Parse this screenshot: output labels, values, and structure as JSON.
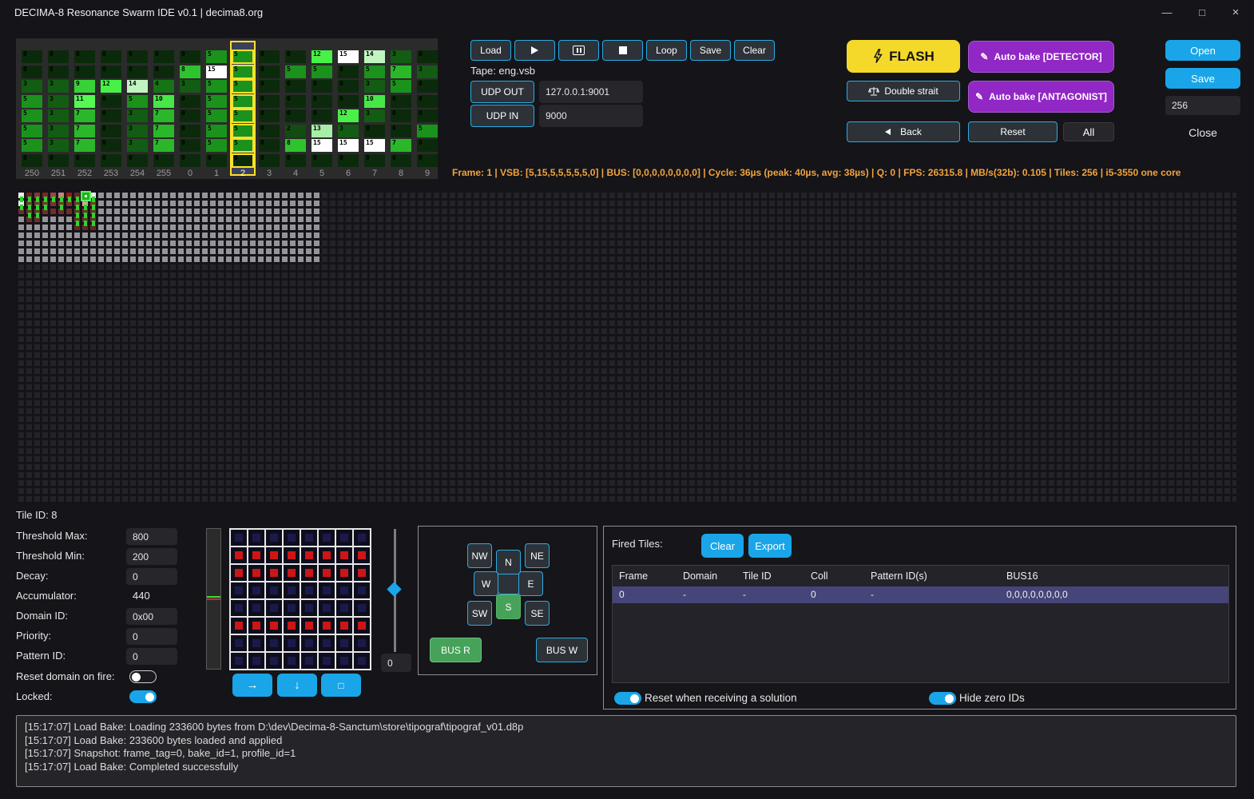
{
  "window": {
    "title": "DECIMA-8 Resonance Swarm IDE v0.1 | decima8.org",
    "minimize": "—",
    "maximize": "□",
    "close": "×"
  },
  "colors": {
    "accent_cyan": "#19a5e8",
    "border_cyan": "#2aabe2",
    "accent_yellow": "#f5d92a",
    "accent_purple": "#9127c4",
    "accent_green": "#46a259",
    "status_orange": "#f2a33c",
    "row_highlight": "#45457a",
    "pattern_red": "#cc1616",
    "pattern_navy": "#1a1a4a"
  },
  "vsb_panel": {
    "selected_index": 8,
    "heat_palette": [
      "#0b2a0b",
      "#0d360d",
      "#124c12",
      "#135c13",
      "#167316",
      "#1b921b",
      "#22a822",
      "#2ab82a",
      "#2ec42e",
      "#38d238",
      "#46e846",
      "#52fa52",
      "#48f048",
      "#a8eea8",
      "#c2f4c2",
      "#ffffff"
    ],
    "columns": [
      {
        "label": "250",
        "values": [
          0,
          0,
          3,
          5,
          5,
          5,
          5,
          0
        ]
      },
      {
        "label": "251",
        "values": [
          0,
          0,
          3,
          3,
          3,
          3,
          3,
          0
        ]
      },
      {
        "label": "252",
        "values": [
          0,
          0,
          9,
          11,
          7,
          7,
          7,
          0
        ]
      },
      {
        "label": "253",
        "values": [
          0,
          0,
          12,
          0,
          0,
          0,
          0,
          0
        ]
      },
      {
        "label": "254",
        "values": [
          0,
          0,
          14,
          5,
          3,
          3,
          3,
          0
        ]
      },
      {
        "label": "255",
        "values": [
          0,
          0,
          4,
          10,
          7,
          7,
          7,
          0
        ]
      },
      {
        "label": "0",
        "values": [
          0,
          8,
          3,
          0,
          0,
          0,
          0,
          0
        ]
      },
      {
        "label": "1",
        "values": [
          5,
          15,
          5,
          5,
          5,
          5,
          5,
          0
        ]
      },
      {
        "label": "2",
        "values": [
          5,
          5,
          5,
          5,
          5,
          5,
          5,
          0
        ]
      },
      {
        "label": "3",
        "values": [
          0,
          0,
          0,
          0,
          0,
          0,
          0,
          0
        ]
      },
      {
        "label": "4",
        "values": [
          0,
          5,
          0,
          0,
          0,
          2,
          8,
          0
        ]
      },
      {
        "label": "5",
        "values": [
          12,
          5,
          0,
          0,
          0,
          13,
          15,
          0
        ]
      },
      {
        "label": "6",
        "values": [
          15,
          0,
          0,
          0,
          12,
          3,
          15,
          0
        ]
      },
      {
        "label": "7",
        "values": [
          14,
          5,
          3,
          10,
          3,
          0,
          15,
          0
        ]
      },
      {
        "label": "8",
        "values": [
          3,
          7,
          5,
          0,
          0,
          0,
          7,
          0
        ]
      },
      {
        "label": "9",
        "values": [
          0,
          3,
          0,
          0,
          0,
          5,
          0,
          0
        ]
      }
    ]
  },
  "transport": {
    "load": "Load",
    "loop": "Loop",
    "save": "Save",
    "clear": "Clear",
    "tape_label": "Tape: eng.vsb",
    "udp_out_button": "UDP OUT",
    "udp_out_value": "127.0.0.1:9001",
    "udp_in_button": "UDP IN",
    "udp_in_value": "9000"
  },
  "bake": {
    "flash": "FLASH",
    "detector": "Auto bake [DETECTOR]",
    "double_strait": "Double strait",
    "antagonist": "Auto bake [ANTAGONIST]",
    "back": "Back",
    "reset": "Reset",
    "all": "All"
  },
  "file_panel": {
    "open": "Open",
    "save": "Save",
    "tiles_value": "256",
    "close": "Close"
  },
  "status_bar": {
    "text": "Frame: 1 | VSB: [5,15,5,5,5,5,5,0] | BUS: [0,0,0,0,0,0,0,0] | Cycle: 36µs (peak: 40µs, avg: 38µs) | Q: 0 | FPS: 26315.8 | MB/s(32b): 0.105 | Tiles: 256 | i5-3550 one core"
  },
  "tile_map": {
    "cols": 152,
    "rows": 39,
    "light_region": {
      "cols": 38,
      "rows": 9
    },
    "selected": {
      "row": 0,
      "col": 8,
      "fill": "#1db51d",
      "border": "#5ef05e"
    },
    "cells": [
      [
        0,
        0,
        "#ececec"
      ],
      [
        0,
        1,
        "#6e2020"
      ],
      [
        0,
        2,
        "#8a3434"
      ],
      [
        0,
        3,
        "#7c2626"
      ],
      [
        0,
        4,
        "#9c4444"
      ],
      [
        0,
        5,
        "#cc8282"
      ],
      [
        0,
        6,
        "#a61414"
      ],
      [
        0,
        7,
        "#682626"
      ],
      [
        0,
        9,
        "#ececec"
      ],
      [
        1,
        0,
        "#ececec"
      ],
      [
        1,
        1,
        "#7c3030"
      ],
      [
        1,
        2,
        "#7c3030"
      ],
      [
        1,
        3,
        "#7c3030"
      ],
      [
        1,
        4,
        "#7c3030"
      ],
      [
        1,
        5,
        "#7c3030"
      ],
      [
        1,
        6,
        "#7c3030"
      ],
      [
        1,
        7,
        "#7c3030"
      ],
      [
        1,
        8,
        "#e2a2a2"
      ],
      [
        1,
        9,
        "#7c3030"
      ],
      [
        2,
        0,
        "#702c2c"
      ],
      [
        2,
        1,
        "#702c2c"
      ],
      [
        2,
        2,
        "#702c2c"
      ],
      [
        2,
        3,
        "#702c2c"
      ],
      [
        2,
        4,
        "#702c2c"
      ],
      [
        2,
        5,
        "#702c2c"
      ],
      [
        2,
        6,
        "#702c2c"
      ],
      [
        2,
        7,
        "#702c2c"
      ],
      [
        2,
        8,
        "#702c2c"
      ],
      [
        2,
        9,
        "#702c2c"
      ],
      [
        3,
        1,
        "#702c2c"
      ],
      [
        3,
        2,
        "#702c2c"
      ],
      [
        3,
        7,
        "#702c2c"
      ],
      [
        3,
        8,
        "#702c2c"
      ],
      [
        3,
        9,
        "#702c2c"
      ],
      [
        4,
        7,
        "#642626"
      ],
      [
        4,
        8,
        "#642626"
      ],
      [
        4,
        9,
        "#642626"
      ]
    ],
    "connectors": [
      [
        0,
        0
      ],
      [
        0,
        1
      ],
      [
        0,
        2
      ],
      [
        0,
        3
      ],
      [
        0,
        4
      ],
      [
        0,
        5
      ],
      [
        0,
        6
      ],
      [
        0,
        7
      ],
      [
        0,
        8
      ],
      [
        0,
        9
      ],
      [
        1,
        0
      ],
      [
        1,
        1
      ],
      [
        1,
        2
      ],
      [
        1,
        3
      ],
      [
        1,
        5
      ],
      [
        1,
        7
      ],
      [
        1,
        8
      ],
      [
        1,
        9
      ],
      [
        2,
        1
      ],
      [
        2,
        2
      ],
      [
        2,
        7
      ],
      [
        2,
        8
      ],
      [
        2,
        9
      ],
      [
        3,
        7
      ],
      [
        3,
        8
      ],
      [
        3,
        9
      ]
    ]
  },
  "inspector": {
    "tile_id_label": "Tile ID: 8",
    "fields": [
      {
        "label": "Threshold Max:",
        "value": "800"
      },
      {
        "label": "Threshold Min:",
        "value": "200"
      },
      {
        "label": "Decay:",
        "value": "0"
      },
      {
        "label": "Accumulator:",
        "value": "440"
      },
      {
        "label": "Domain ID:",
        "value": "0x00"
      },
      {
        "label": "Priority:",
        "value": "0"
      },
      {
        "label": "Pattern ID:",
        "value": "0"
      }
    ],
    "toggles": [
      {
        "label": "Reset domain on fire:",
        "on": false
      },
      {
        "label": "Locked:",
        "on": true
      }
    ]
  },
  "pattern_editor": {
    "rows": [
      [
        0,
        0,
        0,
        0,
        0,
        0,
        0,
        0
      ],
      [
        1,
        1,
        1,
        1,
        1,
        1,
        1,
        1
      ],
      [
        1,
        1,
        1,
        1,
        1,
        1,
        1,
        1
      ],
      [
        0,
        0,
        0,
        0,
        0,
        0,
        0,
        0
      ],
      [
        0,
        0,
        0,
        0,
        0,
        0,
        0,
        0
      ],
      [
        1,
        1,
        1,
        1,
        1,
        1,
        1,
        1
      ],
      [
        0,
        0,
        0,
        0,
        0,
        0,
        0,
        0
      ],
      [
        0,
        0,
        0,
        0,
        0,
        0,
        0,
        0
      ]
    ],
    "slider_value": "0",
    "shift_right": "→",
    "shift_down": "↓",
    "clear_square": "□"
  },
  "compass": {
    "nw": "NW",
    "n": "N",
    "ne": "NE",
    "w": "W",
    "e": "E",
    "sw": "SW",
    "s": "S",
    "se": "SE",
    "active": "S",
    "bus_read": "BUS R",
    "bus_write": "BUS W"
  },
  "fired_tiles": {
    "title": "Fired Tiles:",
    "clear": "Clear",
    "export": "Export",
    "columns": [
      "Frame",
      "Domain",
      "Tile ID",
      "Coll",
      "Pattern ID(s)",
      "BUS16"
    ],
    "rows": [
      [
        "0",
        "-",
        "-",
        "0",
        "-",
        "0,0,0,0,0,0,0,0"
      ]
    ],
    "toggles": [
      {
        "label": "Reset when receiving a solution",
        "on": true
      },
      {
        "label": "Hide zero IDs",
        "on": true
      }
    ]
  },
  "log": {
    "lines": [
      "[15:17:07] Load Bake: Loading 233600 bytes from D:\\dev\\Decima-8-Sanctum\\store\\tipograf\\tipograf_v01.d8p",
      "[15:17:07] Load Bake: 233600 bytes loaded and applied",
      "[15:17:07] Snapshot: frame_tag=0, bake_id=1, profile_id=1",
      "[15:17:07] Load Bake: Completed successfully"
    ]
  }
}
